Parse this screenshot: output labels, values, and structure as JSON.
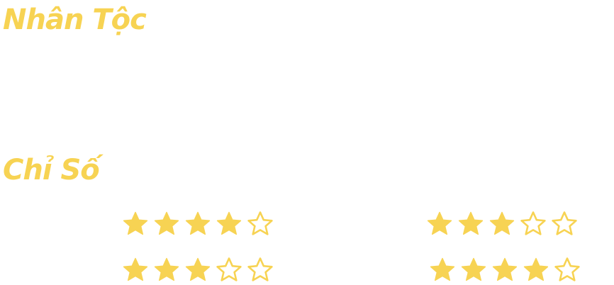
{
  "colors": {
    "accent": "#f7d353",
    "star_fill": "#f7d353",
    "star_outline": "#f7d353"
  },
  "headings": {
    "race": "Nhân Tộc",
    "stats": "Chỉ Số"
  },
  "stats": {
    "max_stars": 5,
    "ratings": [
      {
        "filled": 4
      },
      {
        "filled": 3
      },
      {
        "filled": 3
      },
      {
        "filled": 4
      }
    ]
  },
  "icons": {
    "filled_star": "star-filled-icon",
    "empty_star": "star-outline-icon"
  }
}
